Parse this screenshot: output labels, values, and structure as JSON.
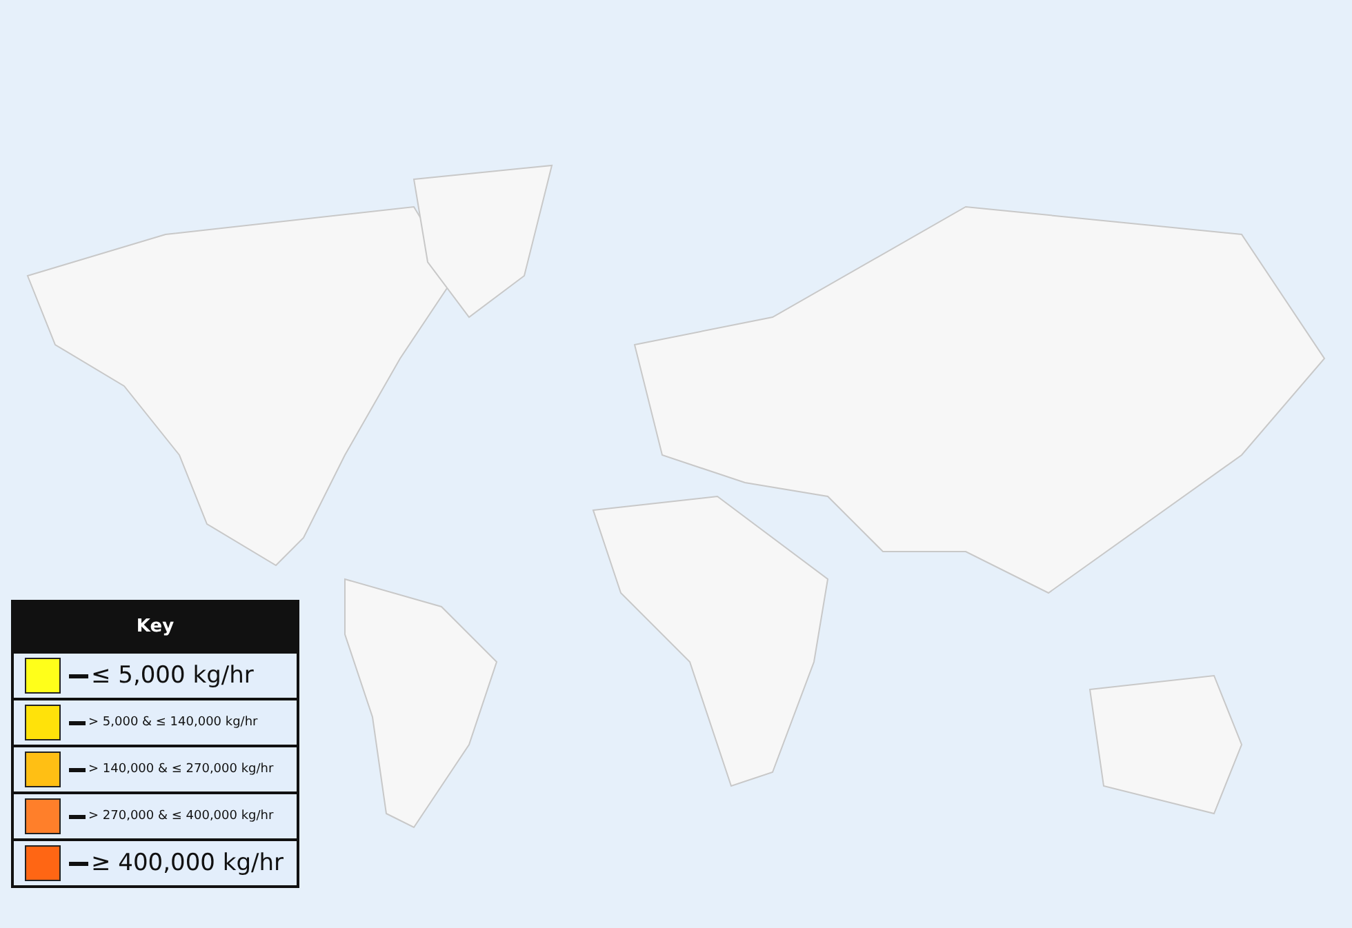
{
  "legend": {
    "title": "Key",
    "entries": [
      {
        "label": "≤ 5,000 kg/hr",
        "kind": "large",
        "color": "#ffff1a"
      },
      {
        "label": "> 5,000 & ≤ 140,000 kg/hr",
        "kind": "small",
        "color": "#ffe20a"
      },
      {
        "label": "> 140,000 & ≤ 270,000 kg/hr",
        "kind": "small",
        "color": "#ffbf14"
      },
      {
        "label": "> 270,000 & ≤ 400,000 kg/hr",
        "kind": "small",
        "color": "#ff7f2a"
      },
      {
        "label": "≥ 400,000 kg/hr",
        "kind": "large",
        "color": "#ff6614"
      }
    ]
  }
}
